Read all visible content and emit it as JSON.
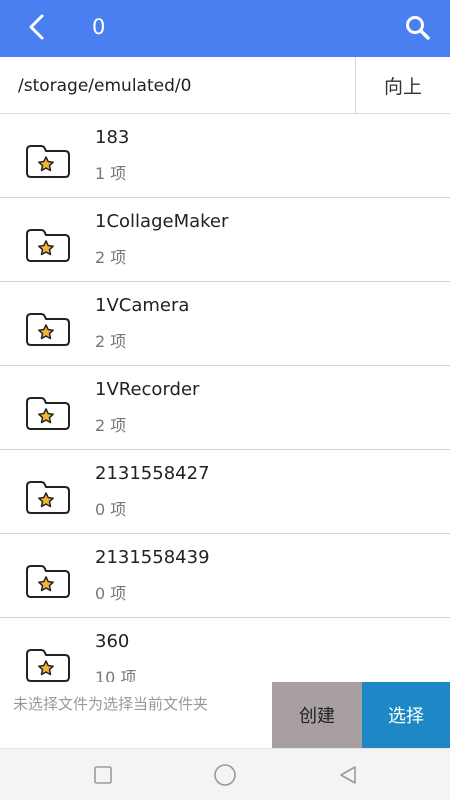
{
  "appbar": {
    "title": "0",
    "back_icon": "back-arrow-icon",
    "search_icon": "search-icon",
    "color": "#4a7ff2"
  },
  "pathbar": {
    "path": "/storage/emulated/0",
    "up_label": "向上"
  },
  "items": [
    {
      "name": "183",
      "count": "1 项"
    },
    {
      "name": "1CollageMaker",
      "count": "2 项"
    },
    {
      "name": "1VCamera",
      "count": "2 项"
    },
    {
      "name": "1VRecorder",
      "count": "2 项"
    },
    {
      "name": "2131558427",
      "count": "0 项"
    },
    {
      "name": "2131558439",
      "count": "0 项"
    },
    {
      "name": "360",
      "count": "10 项"
    }
  ],
  "folder_icon": "starred-folder-icon",
  "bottom": {
    "hint": "未选择文件为选择当前文件夹",
    "create_label": "创建",
    "select_label": "选择",
    "create_color": "#a8a0a0",
    "select_color": "#1e88c7"
  },
  "navbar": {
    "icons": [
      "recents-square-icon",
      "home-circle-icon",
      "back-triangle-icon"
    ]
  }
}
